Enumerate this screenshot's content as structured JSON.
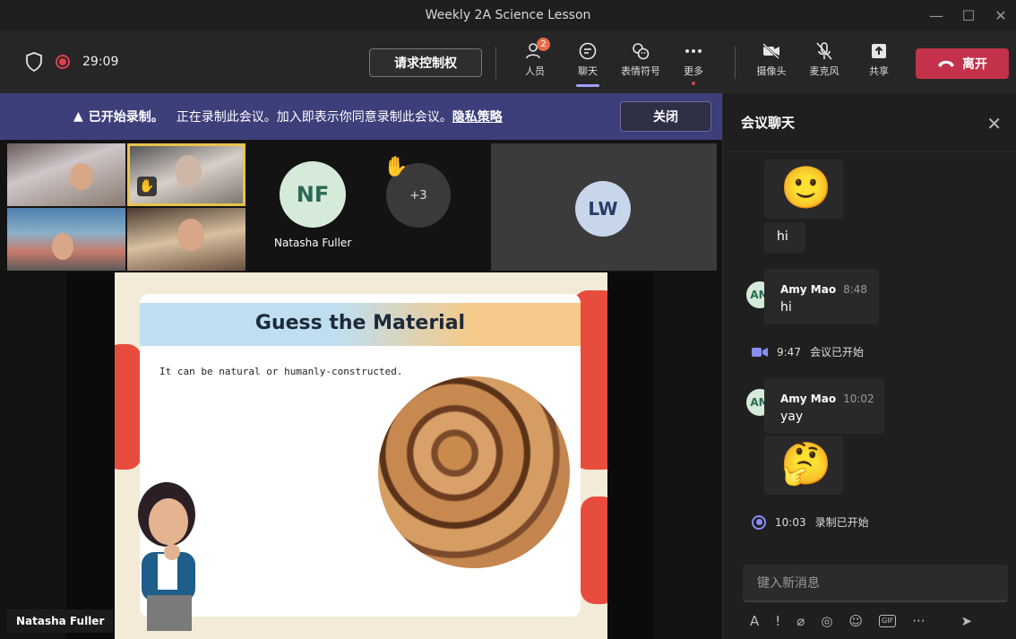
{
  "window": {
    "title": "Weekly 2A Science Lesson"
  },
  "toolbar": {
    "timer": "29:09",
    "request_control": "请求控制权",
    "people_label": "人员",
    "people_badge": "2",
    "chat_label": "聊天",
    "reactions_label": "表情符号",
    "more_label": "更多",
    "camera_label": "摄像头",
    "mic_label": "麦克风",
    "share_label": "共享",
    "leave_label": "离开"
  },
  "banner": {
    "started": "已开始录制。",
    "message": "正在录制此会议。加入即表示你同意录制此会议。",
    "privacy": "隐私策略",
    "close": "关闭"
  },
  "participants": {
    "nf_initials": "NF",
    "nf_name": "Natasha Fuller",
    "overflow": "+3",
    "lw_initials": "LW"
  },
  "slide": {
    "title": "Guess the Material",
    "text": "It can be natural or humanly-constructed."
  },
  "stage": {
    "speaker": "Natasha Fuller"
  },
  "chat": {
    "title": "会议聊天",
    "msg1_text": "hi",
    "msg2": {
      "initials": "AM",
      "sender": "Amy Mao",
      "time": "8:48",
      "text": "hi"
    },
    "sys1": {
      "time": "9:47",
      "text": "会议已开始"
    },
    "msg3": {
      "initials": "AM",
      "sender": "Amy Mao",
      "time": "10:02",
      "text": "yay"
    },
    "sys2": {
      "time": "10:03",
      "text": "录制已开始"
    },
    "compose_placeholder": "键入新消息"
  },
  "colors": {
    "leave": "#c4314b",
    "banner": "#3d3f7a",
    "accent": "#9ea2ff"
  }
}
